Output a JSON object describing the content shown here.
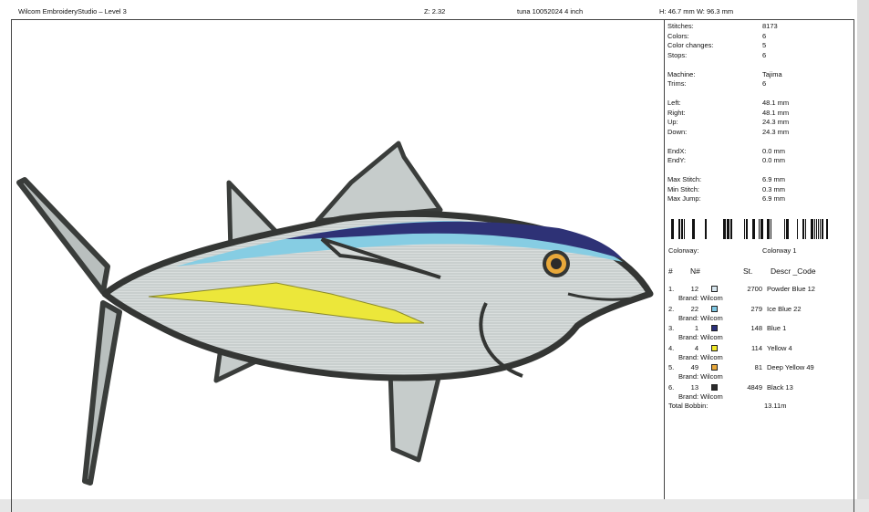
{
  "header": {
    "title": "Wilcom EmbroideryStudio – Level 3",
    "zoom": "Z: 2.32",
    "design_name": "tuna 10052024 4 inch",
    "size": "H: 46.7 mm   W: 96.3 mm"
  },
  "stats": [
    {
      "label": "Stitches:",
      "value": "8173"
    },
    {
      "label": "Colors:",
      "value": "6"
    },
    {
      "label": "Color changes:",
      "value": "5"
    },
    {
      "label": "Stops:",
      "value": "6"
    },
    {
      "label": "Machine:",
      "value": "Tajima"
    },
    {
      "label": "Trims:",
      "value": "6"
    },
    {
      "label": "Left:",
      "value": "48.1 mm"
    },
    {
      "label": "Right:",
      "value": "48.1 mm"
    },
    {
      "label": "Up:",
      "value": "24.3 mm"
    },
    {
      "label": "Down:",
      "value": "24.3 mm"
    },
    {
      "label": "EndX:",
      "value": "0.0 mm"
    },
    {
      "label": "EndY:",
      "value": "0.0 mm"
    },
    {
      "label": "Max Stitch:",
      "value": "6.9 mm"
    },
    {
      "label": "Min Stitch:",
      "value": "0.3 mm"
    },
    {
      "label": "Max Jump:",
      "value": "6.9 mm"
    }
  ],
  "colorway": {
    "label": "Colorway:",
    "value": "Colorway 1"
  },
  "table_headers": {
    "index": "#",
    "number": "N#",
    "stitches": "St.",
    "descr": "Descr _Code"
  },
  "colors": [
    {
      "index": "1.",
      "number": "12",
      "hex": "#d8e6ee",
      "stitches": "2700",
      "name": "Powder Blue 12",
      "brand": "Brand: Wilcom"
    },
    {
      "index": "2.",
      "number": "22",
      "hex": "#7fc8e4",
      "stitches": "279",
      "name": "Ice Blue 22",
      "brand": "Brand: Wilcom"
    },
    {
      "index": "3.",
      "number": "1",
      "hex": "#2a2f7a",
      "stitches": "148",
      "name": "Blue 1",
      "brand": "Brand: Wilcom"
    },
    {
      "index": "4.",
      "number": "4",
      "hex": "#f2ea2a",
      "stitches": "114",
      "name": "Yellow 4",
      "brand": "Brand: Wilcom"
    },
    {
      "index": "5.",
      "number": "49",
      "hex": "#e8a83a",
      "stitches": "81",
      "name": "Deep Yellow 49",
      "brand": "Brand: Wilcom"
    },
    {
      "index": "6.",
      "number": "13",
      "hex": "#2b2b2b",
      "stitches": "4849",
      "name": "Black 13",
      "brand": "Brand: Wilcom"
    }
  ],
  "total_bobbin": {
    "label": "Total Bobbin:",
    "value": "13.11m"
  }
}
